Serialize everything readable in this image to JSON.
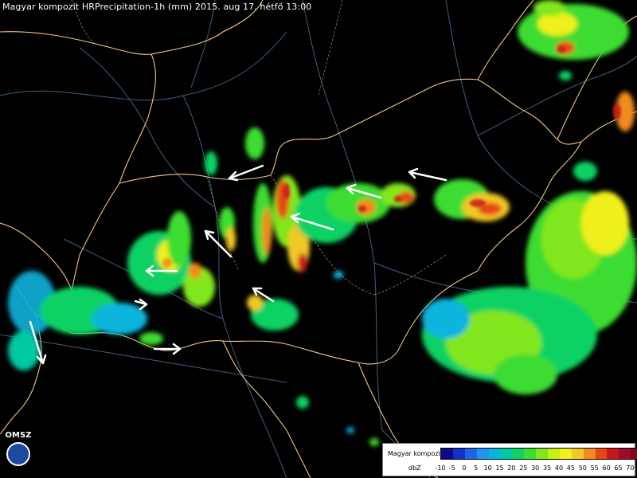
{
  "title": "Magyar kompozit HRPrecipitation-1h (mm) 2015. aug 17. hétfő 13:00",
  "logo": {
    "text": "OMSZ",
    "icon": "omsz-logo-icon"
  },
  "legend": {
    "name": "Magyar kompozit",
    "unit": "dbZ",
    "ticks": [
      "-10",
      "-5",
      "0",
      "5",
      "10",
      "15",
      "20",
      "25",
      "30",
      "35",
      "40",
      "45",
      "50",
      "55",
      "60",
      "65",
      "70"
    ],
    "colors": [
      "#0a0a8c",
      "#1430c8",
      "#1e64e6",
      "#1e96f0",
      "#0ab4dc",
      "#00c8a0",
      "#10d264",
      "#3cdc32",
      "#82e61e",
      "#c8f014",
      "#f0f01e",
      "#f0c828",
      "#f08c1e",
      "#e64614",
      "#c8141e",
      "#a00a28",
      "#780a1e"
    ]
  },
  "colors": {
    "background": "#000000",
    "borders": "#f2c48a",
    "rivers": "#4a6a8a",
    "arrows": "#ffffff"
  }
}
